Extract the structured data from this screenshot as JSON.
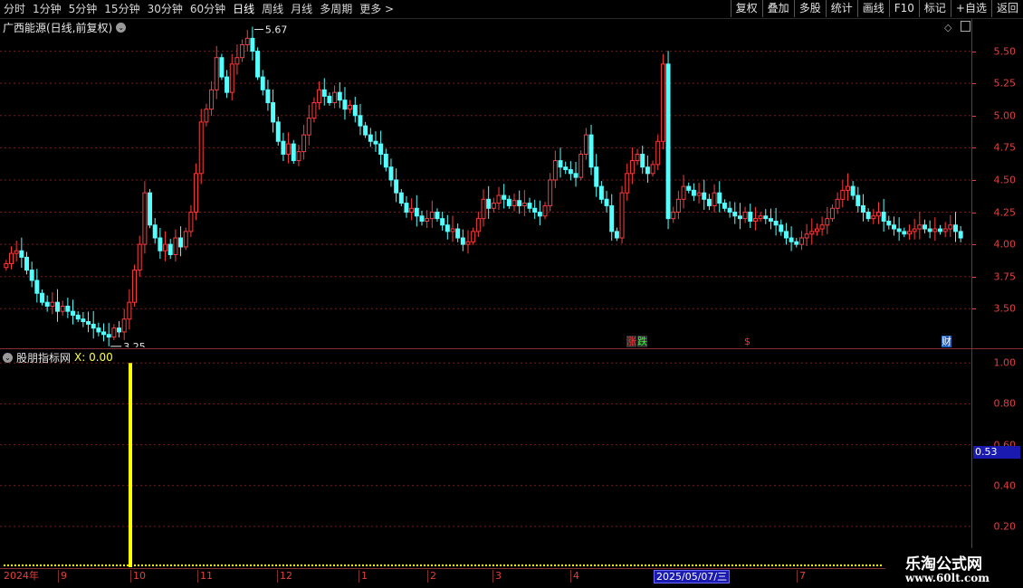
{
  "toolbar": {
    "periods": [
      {
        "label": "分时",
        "active": false
      },
      {
        "label": "1分钟",
        "active": false
      },
      {
        "label": "5分钟",
        "active": false
      },
      {
        "label": "15分钟",
        "active": false
      },
      {
        "label": "30分钟",
        "active": false
      },
      {
        "label": "60分钟",
        "active": false
      },
      {
        "label": "日线",
        "active": true
      },
      {
        "label": "周线",
        "active": false
      },
      {
        "label": "月线",
        "active": false
      },
      {
        "label": "多周期",
        "active": false
      },
      {
        "label": "更多 >",
        "active": false
      }
    ],
    "buttons": [
      "复权",
      "叠加",
      "多股",
      "统计",
      "画线",
      "F10",
      "标记",
      "+自选",
      "返回"
    ]
  },
  "main_panel": {
    "title": "广西能源(日线,前复权)",
    "high_label": "5.67",
    "low_label": "3.25",
    "y_ticks": [
      "5.50",
      "5.25",
      "5.00",
      "4.75",
      "4.50",
      "4.25",
      "4.00",
      "3.75",
      "3.50"
    ],
    "markers": [
      {
        "text": "涨",
        "color": "#ff3030",
        "bg": "#303030"
      },
      {
        "text": "跌",
        "color": "#30ff30",
        "bg": "#303030"
      },
      {
        "text": "$",
        "color": "#ff3030",
        "bg": "#000000"
      },
      {
        "text": "财",
        "color": "#ffffff",
        "bg": "#2060c0"
      }
    ]
  },
  "indicator_panel": {
    "title": "股朋指标网",
    "value_label": "X: 0.00",
    "y_ticks": [
      "1.00",
      "0.80",
      "0.60",
      "0.40",
      "0.20"
    ],
    "current_value": "0.53"
  },
  "date_axis": {
    "ticks": [
      "2024年",
      "9",
      "10",
      "11",
      "12",
      "1",
      "2",
      "3",
      "4",
      "7"
    ],
    "cursor_date": "2025/05/07/三"
  },
  "brand": {
    "name": "乐淘公式网",
    "url": "www.60lt.com"
  },
  "colors": {
    "up": "#ff3b3b",
    "down": "#54ffff",
    "signal": "#ffff00",
    "grid": "#7a1a1a",
    "axis": "#e04040"
  },
  "chart_data": [
    {
      "type": "candlestick",
      "title": "广西能源(日线,前复权)",
      "ylim": [
        3.2,
        5.75
      ],
      "annotations": [
        {
          "label": "5.67",
          "kind": "high"
        },
        {
          "label": "3.25",
          "kind": "low"
        }
      ],
      "close": [
        3.85,
        3.93,
        3.95,
        3.9,
        3.8,
        3.72,
        3.62,
        3.55,
        3.52,
        3.55,
        3.48,
        3.52,
        3.48,
        3.45,
        3.42,
        3.4,
        3.38,
        3.35,
        3.32,
        3.3,
        3.28,
        3.35,
        3.32,
        3.42,
        3.55,
        3.8,
        4.0,
        4.4,
        4.15,
        4.05,
        3.95,
        4.0,
        3.92,
        4.05,
        3.98,
        4.1,
        4.25,
        4.55,
        4.95,
        5.05,
        5.2,
        5.45,
        5.3,
        5.18,
        5.4,
        5.45,
        5.55,
        5.6,
        5.5,
        5.3,
        5.2,
        5.1,
        4.95,
        4.8,
        4.7,
        4.78,
        4.65,
        4.72,
        4.85,
        4.98,
        5.1,
        5.2,
        5.15,
        5.1,
        5.18,
        5.12,
        5.05,
        5.08,
        5.0,
        4.92,
        4.85,
        4.8,
        4.78,
        4.7,
        4.6,
        4.5,
        4.4,
        4.32,
        4.25,
        4.28,
        4.22,
        4.18,
        4.2,
        4.25,
        4.2,
        4.15,
        4.1,
        4.12,
        4.05,
        4.0,
        4.02,
        4.1,
        4.2,
        4.35,
        4.28,
        4.32,
        4.38,
        4.35,
        4.3,
        4.34,
        4.3,
        4.32,
        4.28,
        4.25,
        4.22,
        4.3,
        4.5,
        4.65,
        4.6,
        4.58,
        4.55,
        4.52,
        4.7,
        4.85,
        4.6,
        4.45,
        4.35,
        4.3,
        4.1,
        4.05,
        4.4,
        4.55,
        4.65,
        4.7,
        4.6,
        4.55,
        4.62,
        4.8,
        5.4,
        4.2,
        4.25,
        4.35,
        4.45,
        4.42,
        4.38,
        4.4,
        4.35,
        4.3,
        4.4,
        4.32,
        4.28,
        4.25,
        4.22,
        4.2,
        4.25,
        4.18,
        4.2,
        4.22,
        4.2,
        4.18,
        4.15,
        4.1,
        4.05,
        4.02,
        4.0,
        4.05,
        4.08,
        4.1,
        4.12,
        4.15,
        4.2,
        4.28,
        4.35,
        4.42,
        4.45,
        4.38,
        4.3,
        4.25,
        4.2,
        4.22,
        4.25,
        4.18,
        4.15,
        4.12,
        4.1,
        4.08,
        4.1,
        4.12,
        4.15,
        4.12,
        4.1,
        4.12,
        4.1,
        4.12,
        4.15,
        4.1,
        4.05
      ]
    },
    {
      "type": "bar",
      "title": "股朋指标网",
      "series": [
        {
          "name": "X",
          "values_note": "single spike",
          "spike_value": 1.0,
          "baseline": 0.0
        }
      ],
      "ylim": [
        0,
        1.05
      ]
    }
  ]
}
